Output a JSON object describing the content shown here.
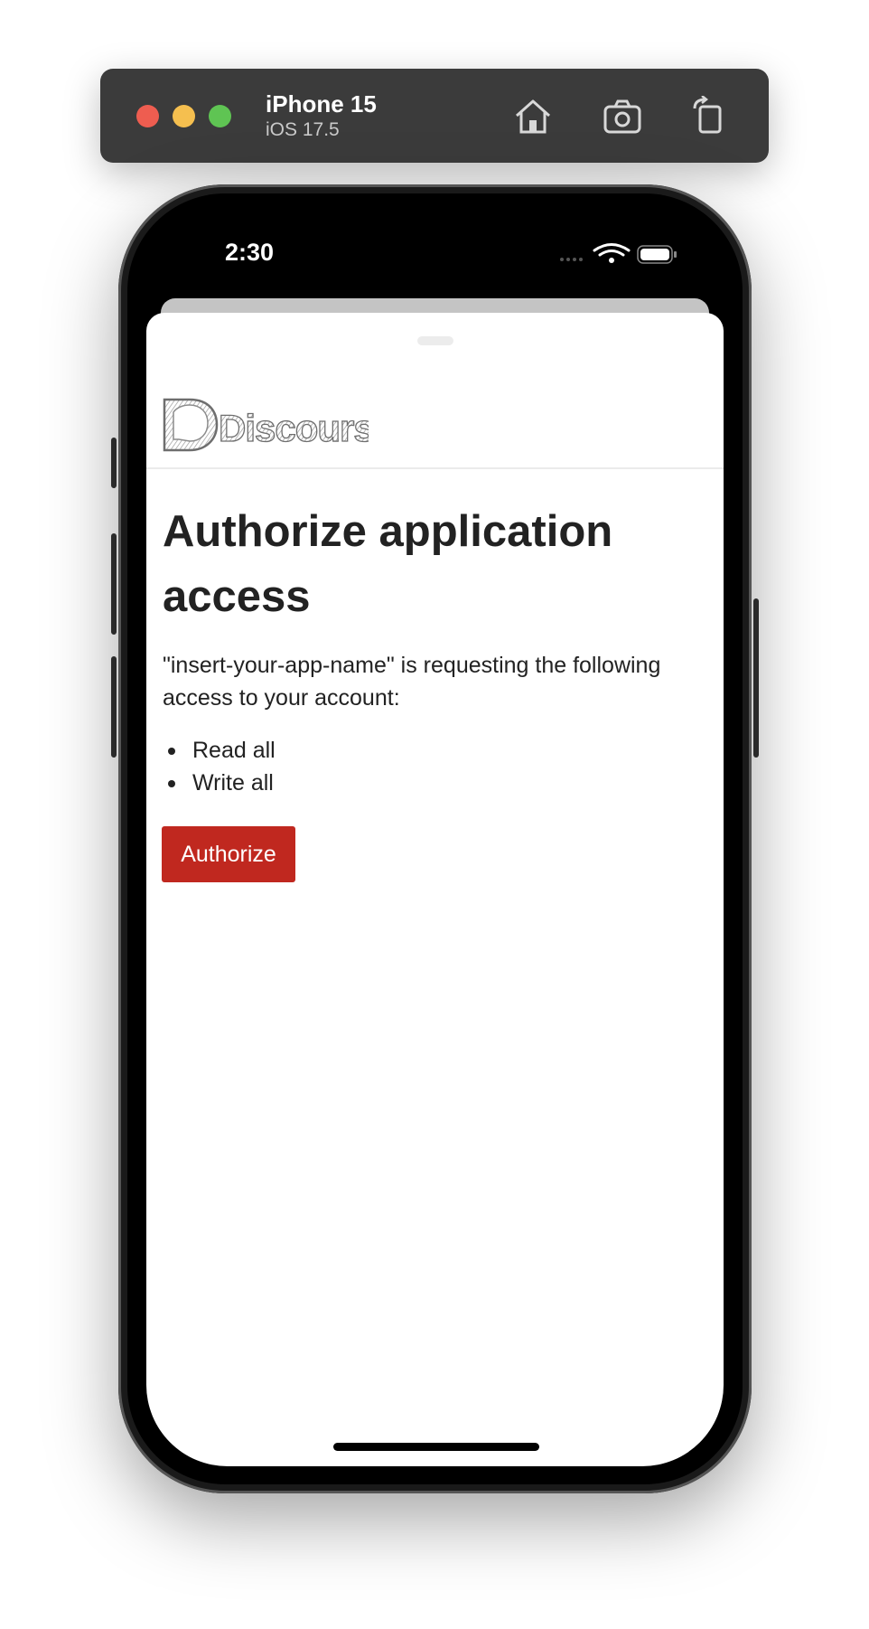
{
  "simulator": {
    "device_name": "iPhone 15",
    "os_version": "iOS 17.5",
    "icons": [
      "home-icon",
      "screenshot-icon",
      "rotate-icon"
    ]
  },
  "status_bar": {
    "time": "2:30",
    "icons": [
      "cellular-dots-icon",
      "wifi-icon",
      "battery-icon"
    ]
  },
  "header": {
    "logo_text": "Discourse"
  },
  "main": {
    "title": "Authorize application access",
    "request_text": "\"insert-your-app-name\" is requesting the following access to your account:",
    "scopes": [
      "Read all",
      "Write all"
    ],
    "authorize_label": "Authorize"
  },
  "colors": {
    "accent": "#c0281f",
    "text": "#222222",
    "toolbar": "#3b3b3b"
  }
}
